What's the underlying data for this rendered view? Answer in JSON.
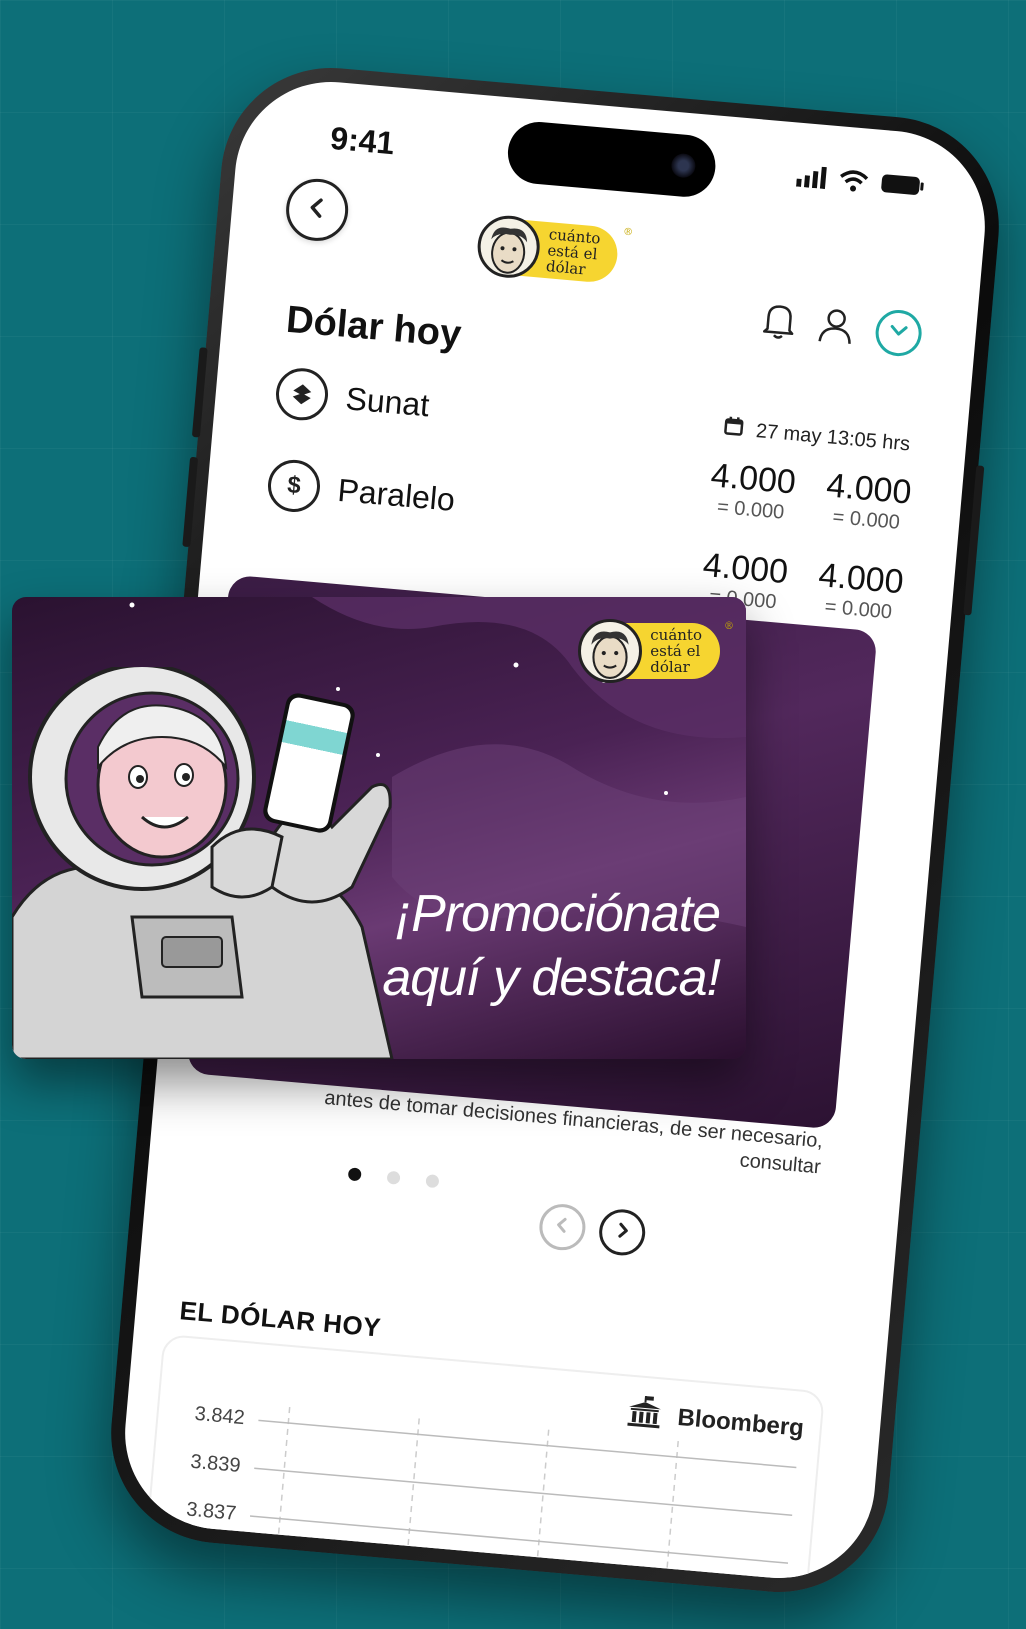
{
  "status_bar": {
    "time": "9:41"
  },
  "logo": {
    "line1": "cuánto",
    "line2": "está el",
    "line3": "dólar",
    "reg": "®"
  },
  "page": {
    "title": "Dólar hoy",
    "date": "27 may 13:05 hrs"
  },
  "rates": [
    {
      "label": "Sunat",
      "icon": "sunat-icon",
      "buy": "4.000",
      "buy_change": "= 0.000",
      "sell": "4.000",
      "sell_change": "= 0.000"
    },
    {
      "label": "Paralelo",
      "icon": "dollar-icon",
      "buy": "4.000",
      "buy_change": "= 0.000",
      "sell": "4.000",
      "sell_change": "= 0.000"
    }
  ],
  "promo": {
    "line1": "¡Promociónate",
    "line2": "aquí y destaca!"
  },
  "disclaimer": "antes de tomar decisiones financieras, de ser necesario, consultar",
  "carousel": {
    "count": 3,
    "active": 0
  },
  "dollar_section": {
    "title": "EL DÓLAR HOY",
    "source": "Bloomberg",
    "y_ticks": [
      "3.842",
      "3.839",
      "3.837"
    ]
  },
  "colors": {
    "accent": "#1fa9a4",
    "logo_yellow": "#f6d530",
    "promo_purple": "#4a2254",
    "background": "#0d6f78"
  }
}
